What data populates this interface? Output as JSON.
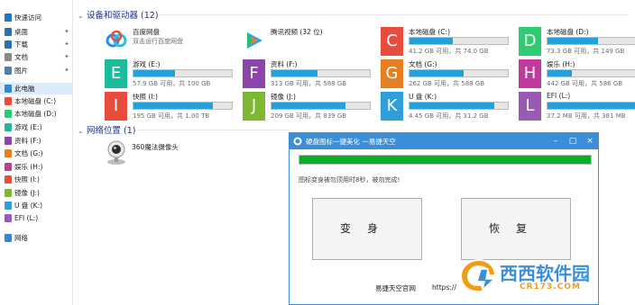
{
  "sidebar": {
    "items": [
      {
        "label": "快速访问",
        "icon": "quick-access-star-icon",
        "color": "#1e78c8",
        "pinned": false,
        "selected": false
      },
      {
        "label": "桌面",
        "icon": "desktop-icon",
        "color": "#2b6fb8",
        "pinned": true,
        "selected": false
      },
      {
        "label": "下载",
        "icon": "download-icon",
        "color": "#2b6fb8",
        "pinned": true,
        "selected": false
      },
      {
        "label": "文档",
        "icon": "documents-icon",
        "color": "#8a8a8a",
        "pinned": true,
        "selected": false
      },
      {
        "label": "图片",
        "icon": "pictures-icon",
        "color": "#4f7fb0",
        "pinned": true,
        "selected": false
      },
      {
        "label": "此电脑",
        "icon": "this-pc-icon",
        "color": "#3a86c8",
        "pinned": false,
        "selected": true
      },
      {
        "label": "本地磁盘 (C:)",
        "icon": "drive-c-icon",
        "color": "#e74c3c",
        "pinned": false,
        "selected": false
      },
      {
        "label": "本地磁盘 (D:)",
        "icon": "drive-d-icon",
        "color": "#2ecc71",
        "pinned": false,
        "selected": false
      },
      {
        "label": "游戏 (E:)",
        "icon": "drive-e-icon",
        "color": "#1abc9c",
        "pinned": false,
        "selected": false
      },
      {
        "label": "资料 (F:)",
        "icon": "drive-f-icon",
        "color": "#8e44ad",
        "pinned": false,
        "selected": false
      },
      {
        "label": "文档 (G:)",
        "icon": "drive-g-icon",
        "color": "#e67e22",
        "pinned": false,
        "selected": false
      },
      {
        "label": "娱乐 (H:)",
        "icon": "drive-h-icon",
        "color": "#c0399d",
        "pinned": false,
        "selected": false
      },
      {
        "label": "快照 (I:)",
        "icon": "drive-i-icon",
        "color": "#e74c3c",
        "pinned": false,
        "selected": false
      },
      {
        "label": "镜像 (J:)",
        "icon": "drive-j-icon",
        "color": "#7cb832",
        "pinned": false,
        "selected": false
      },
      {
        "label": "U 盘 (K:)",
        "icon": "drive-k-icon",
        "color": "#2e9fd8",
        "pinned": false,
        "selected": false
      },
      {
        "label": "EFI (L:)",
        "icon": "drive-l-icon",
        "color": "#9b59b6",
        "pinned": false,
        "selected": false
      },
      {
        "label": "网络",
        "icon": "network-icon",
        "color": "#3a86c8",
        "pinned": false,
        "selected": false
      }
    ]
  },
  "devices": {
    "title": "设备和驱动器 (12)",
    "items": [
      {
        "name": "百度网盘",
        "subtitle": "双击运行百度网盘",
        "icon": "baidu-netdisk-icon",
        "kind": "app"
      },
      {
        "name": "腾讯视频 (32 位)",
        "icon": "tencent-video-icon",
        "kind": "app"
      },
      {
        "name": "本地磁盘 (C:)",
        "letter": "C",
        "color": "#e74c3c",
        "used": 0.44,
        "info": "41.2 GB 可用，共 74.0 GB",
        "kind": "drive"
      },
      {
        "name": "本地磁盘 (D:)",
        "letter": "D",
        "color": "#2ecc71",
        "used": 0.51,
        "info": "73.3 GB 可用，共 149 GB",
        "kind": "drive"
      },
      {
        "name": "游戏 (E:)",
        "letter": "E",
        "color": "#1abc9c",
        "used": 0.42,
        "info": "57.9 GB 可用，共 100 GB",
        "kind": "drive"
      },
      {
        "name": "资料 (F:)",
        "letter": "F",
        "color": "#8e44ad",
        "used": 0.47,
        "info": "313 GB 可用，共 588 GB",
        "kind": "drive"
      },
      {
        "name": "文档 (G:)",
        "letter": "G",
        "color": "#e67e22",
        "used": 0.55,
        "info": "262 GB 可用，共 588 GB",
        "kind": "drive"
      },
      {
        "name": "娱乐 (H:)",
        "letter": "H",
        "color": "#c0399d",
        "used": 0.25,
        "info": "442 GB 可用，共 586 GB",
        "kind": "drive"
      },
      {
        "name": "快照 (I:)",
        "letter": "I",
        "color": "#e74c3c",
        "used": 0.81,
        "info": "195 GB 可用，共 1.00 TB",
        "kind": "drive"
      },
      {
        "name": "镜像 (J:)",
        "letter": "J",
        "color": "#7cb832",
        "used": 0.75,
        "info": "209 GB 可用，共 839 GB",
        "kind": "drive"
      },
      {
        "name": "U 盘 (K:)",
        "letter": "K",
        "color": "#2e9fd8",
        "used": 0.86,
        "info": "4.45 GB 可用，共 31.2 GB",
        "kind": "drive"
      },
      {
        "name": "EFI (L:)",
        "letter": "L",
        "color": "#9b59b6",
        "used": 0.9,
        "info": "37.2 MB 可用，共 381 MB",
        "kind": "drive"
      }
    ]
  },
  "network": {
    "title": "网络位置 (1)",
    "items": [
      {
        "name": "360魔法摄像头",
        "icon": "webcam-icon"
      }
    ]
  },
  "dialog": {
    "title": "硬盘图标一键美化  一易捷天空",
    "progress": 1.0,
    "status": "图标变身被勿顶用时8秒，被勿完成!",
    "transform_label": "变身",
    "restore_label": "恢复",
    "footer_brand": "易捷天空官网",
    "footer_url": "https://",
    "controls": {
      "minimize": "–",
      "maximize": "□",
      "close": "×"
    }
  },
  "watermark": {
    "text": "西西软件园",
    "sub": "CR173.COM"
  }
}
